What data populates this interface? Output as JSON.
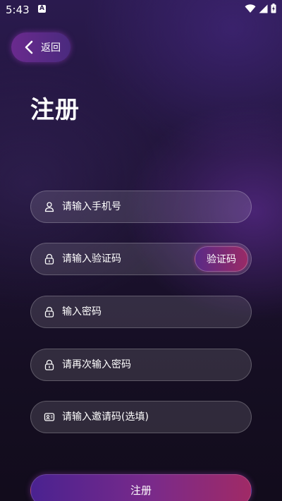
{
  "status_bar": {
    "time": "5:43",
    "notification_icon": "a-letter-icon",
    "icons": [
      "wifi-icon",
      "signal-icon",
      "battery-charging-icon"
    ]
  },
  "header": {
    "back_label": "返回",
    "back_icon": "chevron-left-icon"
  },
  "page": {
    "title": "注册"
  },
  "form": {
    "phone": {
      "placeholder": "请输入手机号",
      "value": "",
      "icon": "user-icon"
    },
    "code": {
      "placeholder": "请输入验证码",
      "value": "",
      "icon": "lock-icon",
      "button_label": "验证码"
    },
    "password": {
      "placeholder": "输入密码",
      "value": "",
      "icon": "lock-icon"
    },
    "confirm_password": {
      "placeholder": "请再次输入密码",
      "value": "",
      "icon": "lock-icon"
    },
    "invite": {
      "placeholder": "请输入邀请码(选填)",
      "value": "",
      "icon": "id-card-icon"
    }
  },
  "actions": {
    "register_label": "注册"
  },
  "colors": {
    "background_top": "#2a1a4e",
    "background_bottom": "#120c1c",
    "accent_purple": "#5a2a86",
    "accent_pink": "#a02a66"
  }
}
